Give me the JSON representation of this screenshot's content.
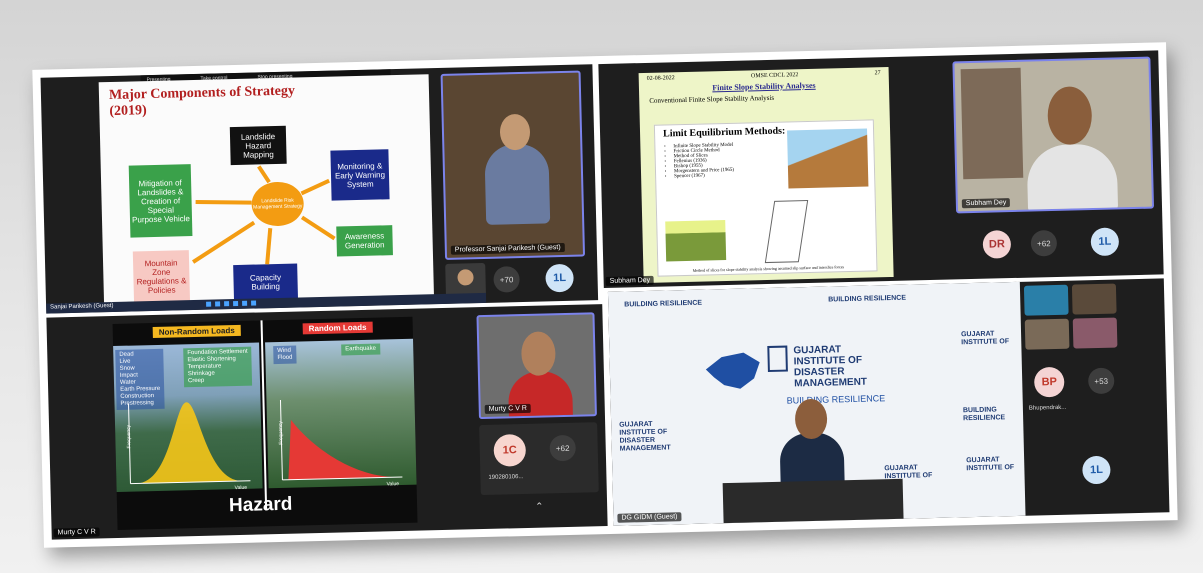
{
  "panel1": {
    "share_bar": [
      "Presenting",
      "Take control",
      "Stop presenting"
    ],
    "slide_title_line1": "Major Components of Strategy",
    "slide_title_line2": "(2019)",
    "boxes": {
      "hazard_mapping": "Landslide Hazard Mapping",
      "mitigation": "Mitigation of Landslides & Creation of Special Purpose Vehicle",
      "monitoring": "Monitoring & Early Warning System",
      "awareness": "Awareness Generation",
      "mountain": "Mountain Zone Regulations & Policies",
      "capacity": "Capacity Building",
      "hub": "Landslide Risk Management Strategy"
    },
    "presenter_name": "Professor Sanjai Parikesh (Guest)",
    "overflow_count": "+70",
    "avatar_initials": "1L",
    "taskbar_label": "Sanjai Parikesh (Guest)"
  },
  "panel2": {
    "slide_date": "02-08-2022",
    "slide_event": "OMSE CDCL 2022",
    "slide_page": "27",
    "slide_title": "Finite Slope Stability Analyses",
    "slide_bullet": "Conventional Finite Slope Stability Analysis",
    "inner_heading": "Limit Equilibrium Methods:",
    "methods": [
      "Infinite Slope Stability Model",
      "Friction Circle Method",
      "Method of Slices",
      "Fellenius (1936)",
      "Bishop (1955)",
      "Morgenstern and Price (1965)",
      "Spencer (1967)"
    ],
    "caption": "Method of slices for slope stability analysis showing assumed slip surface and interslice forces",
    "presenter_name": "Subham Dey",
    "left_label": "Subham Dey",
    "avatar_initials": "DR",
    "overflow_count": "+62",
    "avatar2_initials": "1L"
  },
  "panel3": {
    "label_nonrandom": "Non-Random Loads",
    "label_random": "Random Loads",
    "nonrandom_list": [
      "Dead",
      "Live",
      "Snow",
      "Impact",
      "Water",
      "Earth Pressure",
      "Construction",
      "Prestressing"
    ],
    "nonrandom_list2": [
      "Foundation Settlement",
      "Elastic Shortening",
      "Temperature",
      "Shrinkage",
      "Creep"
    ],
    "random_list": [
      "Wind",
      "Flood"
    ],
    "random_list2": [
      "Earthquake"
    ],
    "axis_freq": "Frequency",
    "axis_value": "Value",
    "hazard_word": "Hazard",
    "presenter_name": "Murty C V R",
    "corner_name": "Murty C V R",
    "avatar_initials": "1C",
    "avatar_caption": "190280106...",
    "overflow_count": "+62"
  },
  "panel4": {
    "org_line1": "GUJARAT",
    "org_line2": "INSTITUTE OF",
    "org_line3": "DISASTER",
    "org_line4": "MANAGEMENT",
    "tagline": "BUILDING RESILIENCE",
    "presenter_name": "DG GIDM (Guest)",
    "avatar_initials": "BP",
    "avatar_caption": "Bhupendrak...",
    "overflow_count": "+53",
    "avatar2_initials": "1L"
  },
  "colors": {
    "accent_ring": "#7b83eb",
    "slide_title_red": "#b21f1f",
    "hub_orange": "#f39c12",
    "box_green": "#3aa14a",
    "box_navy": "#1a2a8a",
    "nonrandom_label": "#f5b820",
    "random_label": "#e53935"
  }
}
